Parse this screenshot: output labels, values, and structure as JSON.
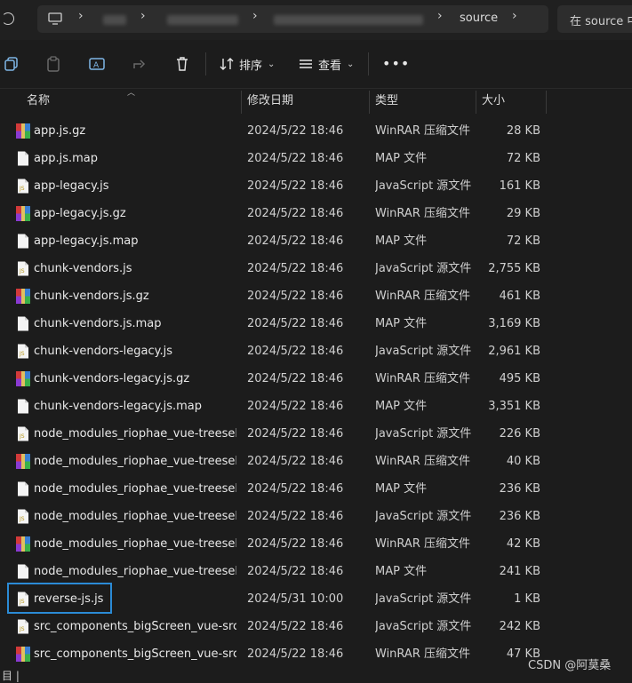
{
  "address": {
    "crumbs": [
      "source"
    ],
    "search_placeholder": "在 source 中"
  },
  "toolbar": {
    "sort_label": "排序",
    "view_label": "查看",
    "more_label": "•••"
  },
  "columns": {
    "name": "名称",
    "date": "修改日期",
    "type": "类型",
    "size": "大小"
  },
  "files": [
    {
      "name": "app.js.gz",
      "date": "2024/5/22 18:46",
      "type": "WinRAR 压缩文件",
      "size": "28 KB",
      "icon": "rar"
    },
    {
      "name": "app.js.map",
      "date": "2024/5/22 18:46",
      "type": "MAP 文件",
      "size": "72 KB",
      "icon": "file"
    },
    {
      "name": "app-legacy.js",
      "date": "2024/5/22 18:46",
      "type": "JavaScript 源文件",
      "size": "161 KB",
      "icon": "js"
    },
    {
      "name": "app-legacy.js.gz",
      "date": "2024/5/22 18:46",
      "type": "WinRAR 压缩文件",
      "size": "29 KB",
      "icon": "rar"
    },
    {
      "name": "app-legacy.js.map",
      "date": "2024/5/22 18:46",
      "type": "MAP 文件",
      "size": "72 KB",
      "icon": "file"
    },
    {
      "name": "chunk-vendors.js",
      "date": "2024/5/22 18:46",
      "type": "JavaScript 源文件",
      "size": "2,755 KB",
      "icon": "js"
    },
    {
      "name": "chunk-vendors.js.gz",
      "date": "2024/5/22 18:46",
      "type": "WinRAR 压缩文件",
      "size": "461 KB",
      "icon": "rar"
    },
    {
      "name": "chunk-vendors.js.map",
      "date": "2024/5/22 18:46",
      "type": "MAP 文件",
      "size": "3,169 KB",
      "icon": "file"
    },
    {
      "name": "chunk-vendors-legacy.js",
      "date": "2024/5/22 18:46",
      "type": "JavaScript 源文件",
      "size": "2,961 KB",
      "icon": "js"
    },
    {
      "name": "chunk-vendors-legacy.js.gz",
      "date": "2024/5/22 18:46",
      "type": "WinRAR 压缩文件",
      "size": "495 KB",
      "icon": "rar"
    },
    {
      "name": "chunk-vendors-legacy.js.map",
      "date": "2024/5/22 18:46",
      "type": "MAP 文件",
      "size": "3,351 KB",
      "icon": "file"
    },
    {
      "name": "node_modules_riophae_vue-treeselec...",
      "date": "2024/5/22 18:46",
      "type": "JavaScript 源文件",
      "size": "226 KB",
      "icon": "js"
    },
    {
      "name": "node_modules_riophae_vue-treeselec...",
      "date": "2024/5/22 18:46",
      "type": "WinRAR 压缩文件",
      "size": "40 KB",
      "icon": "rar"
    },
    {
      "name": "node_modules_riophae_vue-treeselec...",
      "date": "2024/5/22 18:46",
      "type": "MAP 文件",
      "size": "236 KB",
      "icon": "file"
    },
    {
      "name": "node_modules_riophae_vue-treeselec...",
      "date": "2024/5/22 18:46",
      "type": "JavaScript 源文件",
      "size": "236 KB",
      "icon": "js"
    },
    {
      "name": "node_modules_riophae_vue-treeselec...",
      "date": "2024/5/22 18:46",
      "type": "WinRAR 压缩文件",
      "size": "42 KB",
      "icon": "rar"
    },
    {
      "name": "node_modules_riophae_vue-treeselec...",
      "date": "2024/5/22 18:46",
      "type": "MAP 文件",
      "size": "241 KB",
      "icon": "file"
    },
    {
      "name": "reverse-js.js",
      "date": "2024/5/31 10:00",
      "type": "JavaScript 源文件",
      "size": "1 KB",
      "icon": "js"
    },
    {
      "name": "src_components_bigScreen_vue-src_c...",
      "date": "2024/5/22 18:46",
      "type": "JavaScript 源文件",
      "size": "242 KB",
      "icon": "js"
    },
    {
      "name": "src_components_bigScreen_vue-src_c...",
      "date": "2024/5/22 18:46",
      "type": "WinRAR 压缩文件",
      "size": "47 KB",
      "icon": "rar"
    }
  ],
  "watermark": "CSDN @阿莫桑",
  "status_text": "目 |",
  "colors": {
    "accent": "#7fb6e6",
    "selection": "#2b8bd6",
    "background": "#1c1c1c"
  }
}
